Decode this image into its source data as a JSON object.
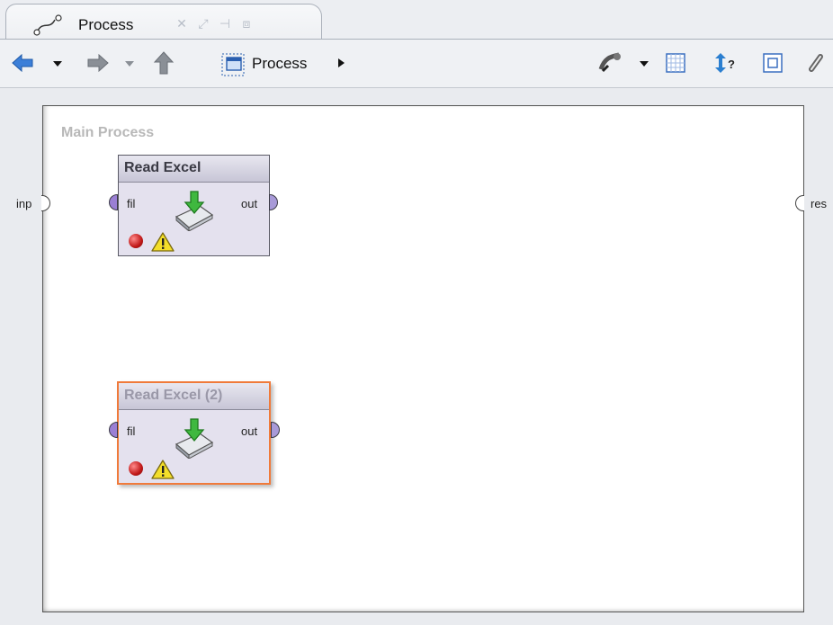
{
  "tab": {
    "title": "Process",
    "icon": "process-flow-icon",
    "buttons": [
      "close-icon",
      "maximize-icon",
      "restore-icon",
      "pin-icon"
    ]
  },
  "toolbar": {
    "back_icon": "back-arrow-icon",
    "forward_icon": "forward-arrow-icon",
    "up_icon": "up-arrow-icon",
    "breadcrumb_label": "Process",
    "breadcrumb_icon": "subprocess-icon",
    "right_icons": [
      "auto-wire-icon",
      "arrange-grid-icon",
      "order-execution-icon",
      "fit-view-icon",
      "link-icon"
    ]
  },
  "canvas": {
    "title": "Main Process",
    "left_port_label": "inp",
    "right_port_label": "res"
  },
  "operators": [
    {
      "name": "Read Excel",
      "in_port": "fil",
      "out_port": "out",
      "selected": false
    },
    {
      "name": "Read Excel (2)",
      "in_port": "fil",
      "out_port": "out",
      "selected": true
    }
  ],
  "colors": {
    "selection": "#f07a3a",
    "port_fill": "#9a7fd4",
    "operator_bg": "#e4e1ee",
    "status_error": "#c01818",
    "warning": "#f3de2a"
  }
}
